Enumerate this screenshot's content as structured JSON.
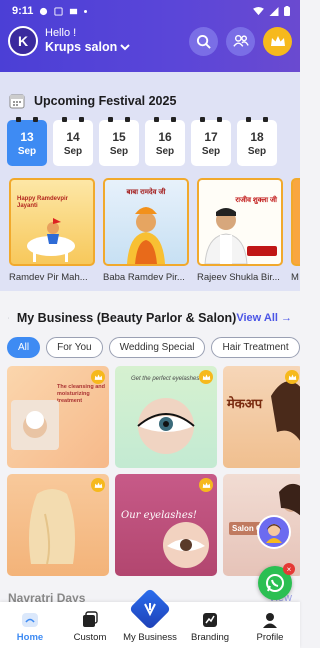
{
  "status_bar": {
    "time": "9:11"
  },
  "header": {
    "avatar_letter": "K",
    "greeting": "Hello !",
    "business_name": "Krups salon"
  },
  "festival": {
    "title": "Upcoming Festival 2025",
    "dates": [
      {
        "day": "13",
        "month": "Sep",
        "selected": true
      },
      {
        "day": "14",
        "month": "Sep",
        "selected": false
      },
      {
        "day": "15",
        "month": "Sep",
        "selected": false
      },
      {
        "day": "16",
        "month": "Sep",
        "selected": false
      },
      {
        "day": "17",
        "month": "Sep",
        "selected": false
      },
      {
        "day": "18",
        "month": "Sep",
        "selected": false
      }
    ],
    "cards": [
      {
        "caption": "Ramdev Pir Mah...",
        "poster_text": "Happy Ramdevpir Jayanti"
      },
      {
        "caption": "Baba Ramdev Pir...",
        "poster_text": "बाबा रामदेव जी"
      },
      {
        "caption": "Rajeev Shukla Bir...",
        "poster_text": "राजीव शुक्ला जी"
      },
      {
        "caption": "M"
      }
    ]
  },
  "business": {
    "title": "My Business (Beauty Parlor & Salon)",
    "view_all": "View All →",
    "chips": [
      "All",
      "For You",
      "Wedding Special",
      "Hair Treatment"
    ],
    "active_chip": "All",
    "tiles": [
      {
        "text": "The cleansing and moisturizing treatment"
      },
      {
        "text": "Get the perfect eyelashes!"
      },
      {
        "text": "मेकअप"
      },
      {
        "text": ""
      },
      {
        "text": "Our eyelashes!"
      },
      {
        "text": "Salon O"
      }
    ]
  },
  "next_section": {
    "title": "Navratri Days",
    "view_all": "View"
  },
  "bottom_nav": [
    {
      "label": "Home",
      "icon": "home-icon",
      "active": true
    },
    {
      "label": "Custom",
      "icon": "custom-icon",
      "active": false
    },
    {
      "label": "My Business",
      "icon": "my-business-icon",
      "active": false
    },
    {
      "label": "Branding",
      "icon": "branding-icon",
      "active": false
    },
    {
      "label": "Profile",
      "icon": "profile-icon",
      "active": false
    }
  ],
  "colors": {
    "header_bg": "#4b3fd6",
    "accent_blue": "#3e8bf3",
    "crown_gold": "#f6b91d",
    "festival_bg": "#dfe2f5",
    "whatsapp_green": "#2bbf52"
  }
}
